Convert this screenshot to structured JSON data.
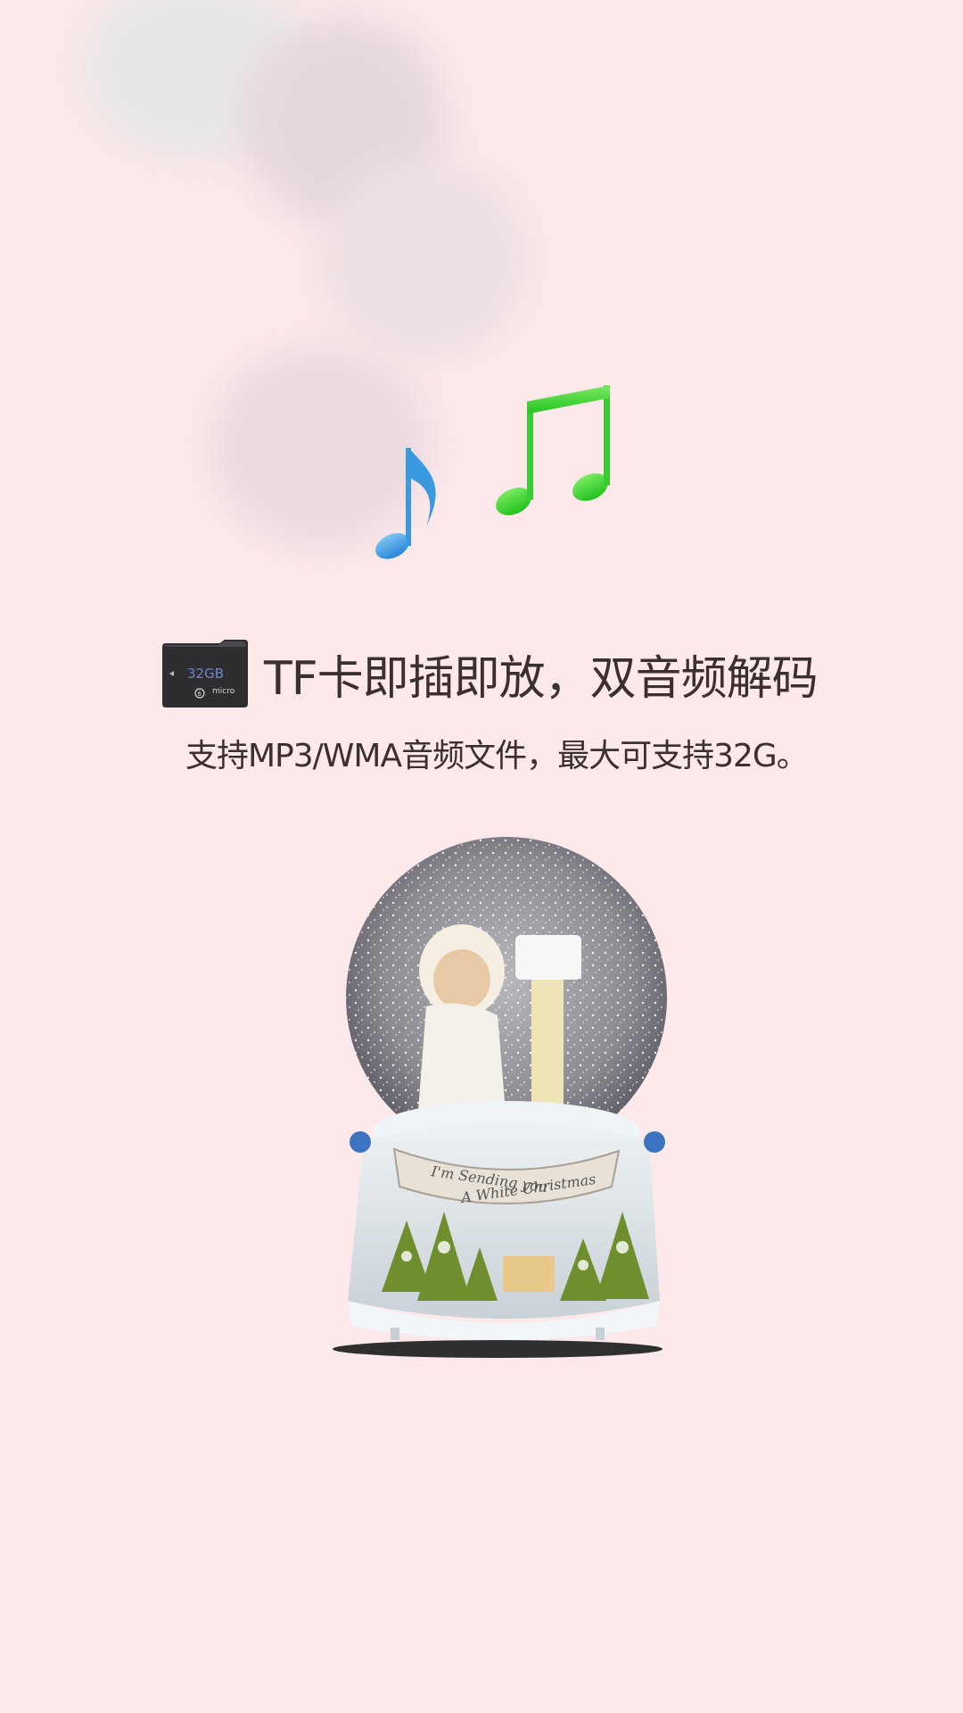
{
  "headline": "TF卡即插即放，双音频解码",
  "subheadline": "支持MP3/WMA音频文件，最大可支持32G。",
  "sd_card": {
    "capacity": "32GB",
    "brand": "micro",
    "class": "6"
  },
  "product": {
    "banner_line1": "I'm Sending you",
    "banner_line2": "A White Christmas"
  },
  "colors": {
    "background": "#fde8ea",
    "note_blue": "#3a9ae0",
    "note_green": "#3fd43a"
  }
}
